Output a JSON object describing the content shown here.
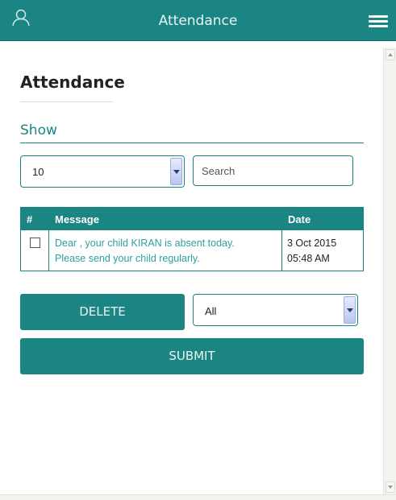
{
  "header": {
    "title": "Attendance",
    "user_icon": "user-icon",
    "menu_icon": "hamburger-menu-icon"
  },
  "page": {
    "title": "Attendance",
    "show_label": "Show"
  },
  "controls": {
    "page_size": "10",
    "search_placeholder": "Search"
  },
  "table": {
    "headers": {
      "select": "#",
      "message": "Message",
      "date": "Date"
    },
    "rows": [
      {
        "checked": false,
        "message_line1": "Dear , your child KIRAN is absent today.",
        "message_line2": "Please send your child regularly.",
        "date_line1": "3 Oct 2015",
        "date_line2": "05:48 AM"
      }
    ]
  },
  "actions": {
    "delete_label": "DELETE",
    "filter_value": "All",
    "submit_label": "SUBMIT"
  },
  "colors": {
    "primary": "#1b8583",
    "message_text": "#2c9fa0"
  }
}
